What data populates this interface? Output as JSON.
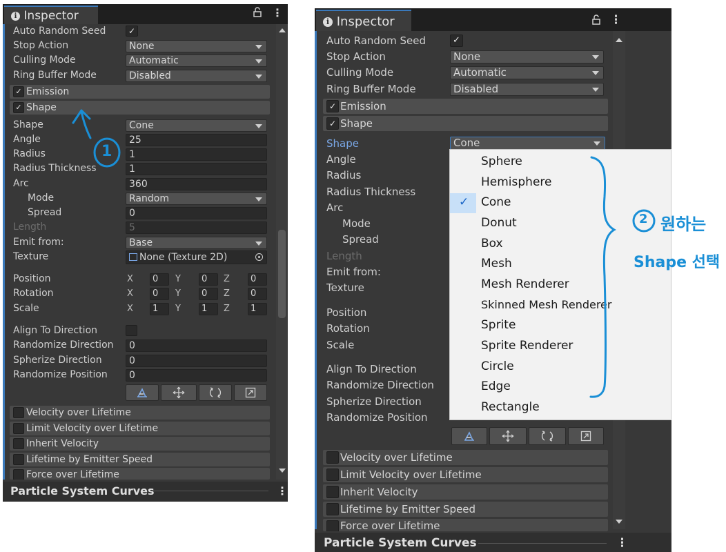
{
  "inspector_tab": {
    "title": "Inspector",
    "lock_icon": "lock-icon",
    "menu_icon": "kebab-menu-icon"
  },
  "main": {
    "auto_random_seed": {
      "label": "Auto Random Seed",
      "checked": true
    },
    "stop_action": {
      "label": "Stop Action",
      "value": "None"
    },
    "culling_mode": {
      "label": "Culling Mode",
      "value": "Automatic"
    },
    "ring_buffer_mode": {
      "label": "Ring Buffer Mode",
      "value": "Disabled"
    }
  },
  "modules_top": [
    {
      "label": "Emission",
      "checked": true
    },
    {
      "label": "Shape",
      "checked": true
    }
  ],
  "shape_module": {
    "shape": {
      "label": "Shape",
      "value": "Cone"
    },
    "angle": {
      "label": "Angle",
      "value": "25"
    },
    "radius": {
      "label": "Radius",
      "value": "1"
    },
    "radius_thickness": {
      "label": "Radius Thickness",
      "value": "1"
    },
    "arc": {
      "label": "Arc",
      "value": "360"
    },
    "mode": {
      "label": "Mode",
      "value": "Random"
    },
    "spread": {
      "label": "Spread",
      "value": "0"
    },
    "length": {
      "label": "Length",
      "value": "5"
    },
    "emit_from": {
      "label": "Emit from:",
      "value": "Base"
    },
    "texture": {
      "label": "Texture",
      "value": "None (Texture 2D)"
    },
    "position": {
      "label": "Position",
      "x": "0",
      "y": "0",
      "z": "0"
    },
    "rotation": {
      "label": "Rotation",
      "x": "0",
      "y": "0",
      "z": "0"
    },
    "scale": {
      "label": "Scale",
      "x": "1",
      "y": "1",
      "z": "1"
    },
    "axis_labels": {
      "x": "X",
      "y": "Y",
      "z": "Z"
    },
    "align_to_direction": {
      "label": "Align To Direction",
      "checked": false
    },
    "randomize_direction": {
      "label": "Randomize Direction",
      "value": "0"
    },
    "spherize_direction": {
      "label": "Spherize Direction",
      "value": "0"
    },
    "randomize_position": {
      "label": "Randomize Position",
      "value": "0"
    },
    "tool_icons": [
      "edit-shape-icon",
      "move-icon",
      "rotate-icon",
      "scale-icon"
    ]
  },
  "modules_bottom": [
    {
      "label": "Velocity over Lifetime",
      "checked": false
    },
    {
      "label": "Limit Velocity over Lifetime",
      "checked": false
    },
    {
      "label": "Inherit Velocity",
      "checked": false
    },
    {
      "label": "Lifetime by Emitter Speed",
      "checked": false
    },
    {
      "label": "Force over Lifetime",
      "checked": false
    }
  ],
  "footer": {
    "title": "Particle System Curves"
  },
  "shape_dropdown": {
    "selected": "Cone",
    "options": [
      "Sphere",
      "Hemisphere",
      "Cone",
      "Donut",
      "Box",
      "Mesh",
      "Mesh Renderer",
      "Skinned Mesh Renderer",
      "Sprite",
      "Sprite Renderer",
      "Circle",
      "Edge",
      "Rectangle"
    ]
  },
  "annotations": {
    "step1": "1",
    "step2": "2",
    "step2_text_line1": "원하는",
    "step2_text_line2": "Shape 선택",
    "accent_color": "#1a8fd6"
  },
  "colors": {
    "panel_bg": "#383838",
    "field_bg": "#2a2a2a",
    "dropdown_bg": "#515151",
    "module_bg": "#4a4a4a",
    "selection_blue": "#3a79bb",
    "menu_bg": "#f2f2f2"
  }
}
